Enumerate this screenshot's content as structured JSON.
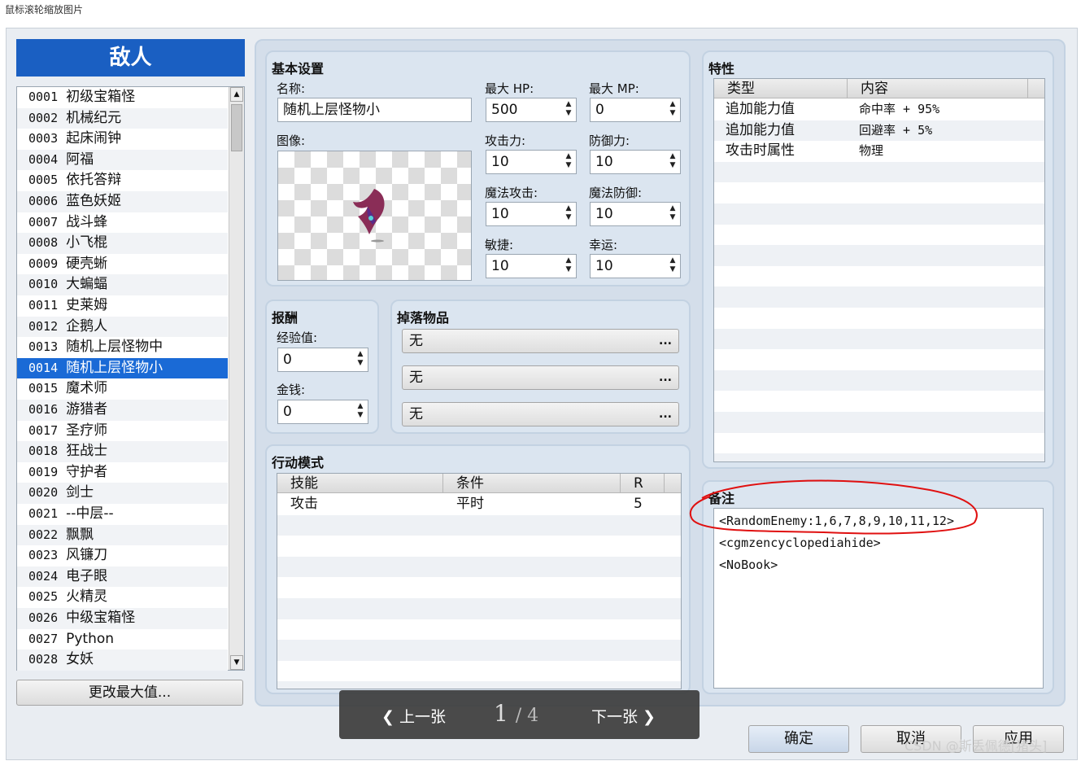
{
  "hint": "鼠标滚轮缩放图片",
  "enemies": {
    "title": "敌人",
    "items": [
      {
        "num": "0001",
        "name": "初级宝箱怪"
      },
      {
        "num": "0002",
        "name": "机械纪元"
      },
      {
        "num": "0003",
        "name": "起床闹钟"
      },
      {
        "num": "0004",
        "name": "阿福"
      },
      {
        "num": "0005",
        "name": "依托答辩"
      },
      {
        "num": "0006",
        "name": "蓝色妖姬"
      },
      {
        "num": "0007",
        "name": "战斗蜂"
      },
      {
        "num": "0008",
        "name": "小飞棍"
      },
      {
        "num": "0009",
        "name": "硬壳蜥"
      },
      {
        "num": "0010",
        "name": "大蝙蝠"
      },
      {
        "num": "0011",
        "name": "史莱姆"
      },
      {
        "num": "0012",
        "name": "企鹅人"
      },
      {
        "num": "0013",
        "name": "随机上层怪物中"
      },
      {
        "num": "0014",
        "name": "随机上层怪物小"
      },
      {
        "num": "0015",
        "name": "魔术师"
      },
      {
        "num": "0016",
        "name": "游猎者"
      },
      {
        "num": "0017",
        "name": "圣疗师"
      },
      {
        "num": "0018",
        "name": "狂战士"
      },
      {
        "num": "0019",
        "name": "守护者"
      },
      {
        "num": "0020",
        "name": "剑士"
      },
      {
        "num": "0021",
        "name": "--中层--"
      },
      {
        "num": "0022",
        "name": "飘飘"
      },
      {
        "num": "0023",
        "name": "风镰刀"
      },
      {
        "num": "0024",
        "name": "电子眼"
      },
      {
        "num": "0025",
        "name": "火精灵"
      },
      {
        "num": "0026",
        "name": "中级宝箱怪"
      },
      {
        "num": "0027",
        "name": "Python"
      },
      {
        "num": "0028",
        "name": "女妖"
      }
    ],
    "selected_index": 13,
    "change_max_label": "更改最大值..."
  },
  "basic": {
    "title": "基本设置",
    "name_label": "名称:",
    "name_value": "随机上层怪物小",
    "image_label": "图像:",
    "max_hp_label": "最大 HP:",
    "max_hp": "500",
    "max_mp_label": "最大 MP:",
    "max_mp": "0",
    "atk_label": "攻击力:",
    "atk": "10",
    "def_label": "防御力:",
    "def": "10",
    "mat_label": "魔法攻击:",
    "mat": "10",
    "mdf_label": "魔法防御:",
    "mdf": "10",
    "agi_label": "敏捷:",
    "agi": "10",
    "luk_label": "幸运:",
    "luk": "10"
  },
  "reward": {
    "title": "报酬",
    "exp_label": "经验值:",
    "exp": "0",
    "gold_label": "金钱:",
    "gold": "0"
  },
  "drops": {
    "title": "掉落物品",
    "items": [
      "无",
      "无",
      "无"
    ],
    "more_label": "..."
  },
  "actions": {
    "title": "行动模式",
    "columns": [
      "技能",
      "条件",
      "R"
    ],
    "rows": [
      {
        "skill": "攻击",
        "condition": "平时",
        "r": "5"
      }
    ]
  },
  "traits": {
    "title": "特性",
    "columns": [
      "类型",
      "内容"
    ],
    "rows": [
      {
        "type": "追加能力值",
        "content": "命中率 + 95%"
      },
      {
        "type": "追加能力值",
        "content": "回避率 + 5%"
      },
      {
        "type": "攻击时属性",
        "content": "物理"
      }
    ]
  },
  "note": {
    "title": "备注",
    "lines": [
      "<RandomEnemy:1,6,7,8,9,10,11,12>",
      "<cgmzencyclopediahide>",
      "<NoBook>"
    ]
  },
  "viewer": {
    "prev": "上一张",
    "next": "下一张",
    "current": "1",
    "total": "/ 4"
  },
  "footer": {
    "ok": "确定",
    "cancel": "取消",
    "apply": "应用"
  },
  "watermark": "CSDN @斯丢佩德[猪头]",
  "colors": {
    "selection": "#1a6ad6",
    "header": "#1a5fc2",
    "annotation": "#e01010"
  }
}
